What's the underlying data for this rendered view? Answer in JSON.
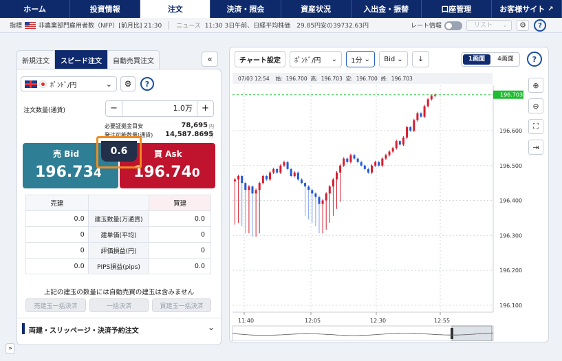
{
  "nav": [
    "ホーム",
    "投資情報",
    "注文",
    "決済・照会",
    "資産状況",
    "入出金・振替",
    "口座管理",
    "お客様サイト"
  ],
  "ticker": {
    "label_indicator": "指標",
    "indicator_text": "非農業部門雇用者数（NFP）[前月比] 21:30",
    "label_news": "ニュース",
    "news_text": "11:30 3日午前、日経平均株価　29.85円安の39732.63円",
    "rate_info_label": "レート情報",
    "list_label": "リスト"
  },
  "order_tabs": [
    "新規注文",
    "スピード注文",
    "自動売買注文"
  ],
  "currency_pair": "ﾎﾟﾝﾄﾞ/円",
  "order_qty_label": "注文数量(通貨)",
  "order_qty_value": "1.0万",
  "margin_label": "必要証拠金目安",
  "margin_value": "78,695",
  "available_label": "発注可能数量(通貨)",
  "available_value": "14,587.8695",
  "unit_yen": "円",
  "unit_man": "万",
  "sell": {
    "label": "売 Bid",
    "price_main": "196.73",
    "price_last": "4"
  },
  "buy": {
    "label": "買 Ask",
    "price_main": "196.74",
    "price_last": "0"
  },
  "spread": "0.6",
  "positions": {
    "header_sell": "売建",
    "header_buy": "買建",
    "rows": [
      {
        "sell": "0.0",
        "label": "建玉数量(万通貨)",
        "buy": "0.0"
      },
      {
        "sell": "0",
        "label": "建単価(平均)",
        "buy": "0"
      },
      {
        "sell": "0",
        "label": "評価損益(円)",
        "buy": "0"
      },
      {
        "sell": "0.0",
        "label": "PIPS損益(pips)",
        "buy": "0.0"
      }
    ]
  },
  "note": "上記の建玉の数量には自動売買の建玉は含みません",
  "bulk_buttons": [
    "売建玉一括決済",
    "一括決済",
    "買建玉一括決済"
  ],
  "accordion_label": "両建・スリッページ・決済予約注文",
  "chart_toolbar": {
    "settings": "チャート設定",
    "pair": "ﾎﾟﾝﾄﾞ/円",
    "interval": "1分",
    "price_type": "Bid",
    "layout1": "1画面",
    "layout4": "4画面"
  },
  "ohlc": {
    "time": "07/03 12:54",
    "open_label": "始:",
    "open": "196.700",
    "high_label": "高:",
    "high": "196.703",
    "low_label": "安:",
    "low": "196.700",
    "close_label": "終:",
    "close": "196.703"
  },
  "last_price_tag": "196.703",
  "chart_data": {
    "type": "candlestick",
    "y_ticks": [
      "196.600",
      "196.500",
      "196.400",
      "196.300",
      "196.200",
      "196.100"
    ],
    "x_ticks": [
      "11:40",
      "12:05",
      "12:30",
      "12:55"
    ],
    "ylim": [
      196.08,
      196.73
    ],
    "close_series": [
      196.46,
      196.47,
      196.45,
      196.43,
      196.44,
      196.42,
      196.43,
      196.45,
      196.47,
      196.46,
      196.48,
      196.49,
      196.48,
      196.5,
      196.51,
      196.49,
      196.47,
      196.48,
      196.46,
      196.45,
      196.44,
      196.43,
      196.42,
      196.41,
      196.39,
      196.4,
      196.42,
      196.44,
      196.46,
      196.48,
      196.5,
      196.52,
      196.51,
      196.53,
      196.52,
      196.51,
      196.5,
      196.49,
      196.48,
      196.5,
      196.51,
      196.5,
      196.52,
      196.53,
      196.54,
      196.55,
      196.57,
      196.56,
      196.58,
      196.61,
      196.6,
      196.63,
      196.65,
      196.64,
      196.67,
      196.69,
      196.7,
      196.703
    ]
  }
}
